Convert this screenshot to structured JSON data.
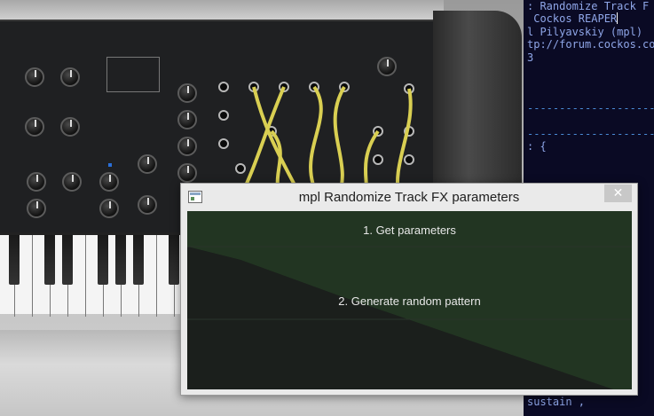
{
  "editor": {
    "lines": [
      ": Randomize Track F",
      " Cockos REAPER",
      "l Pilyavskiy (mpl)",
      "tp://forum.cockos.co",
      "3",
      "",
      "",
      "",
      "----------------------",
      "",
      "----------------------",
      ": {",
      "",
      "",
      "",
      "",
      "",
      "",
      "",
      "",
      "",
      "",
      "",
      "",
      "",
      "",
      "",
      "",
      "",
      "",
      "",
      "sustain ,"
    ]
  },
  "dialog": {
    "title": "mpl Randomize Track FX parameters",
    "close_label": "✕",
    "buttons": [
      {
        "label": "1. Get parameters"
      },
      {
        "label": "2. Generate random pattern"
      }
    ]
  },
  "colors": {
    "client_bg": "#1a1c1a",
    "band_green": "#233823",
    "editor_bg": "#0a0a24",
    "editor_text": "#8fa6e8"
  },
  "icons": {
    "window": "app-window-icon",
    "close": "close-icon"
  }
}
